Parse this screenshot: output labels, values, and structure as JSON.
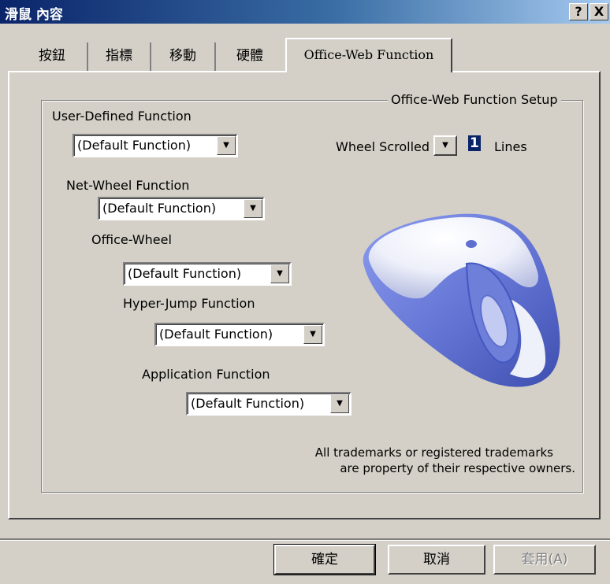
{
  "window": {
    "title": "滑鼠 內容",
    "help_label": "?",
    "close_label": "X"
  },
  "tabs": [
    {
      "label": "按鈕"
    },
    {
      "label": "指標"
    },
    {
      "label": "移動"
    },
    {
      "label": "硬體"
    },
    {
      "label": "Office-Web Function"
    }
  ],
  "group": {
    "title": "Office-Web Function Setup"
  },
  "fields": {
    "user_defined": {
      "label": "User-Defined Function",
      "value": "(Default Function)"
    },
    "net_wheel": {
      "label": "Net-Wheel Function",
      "value": "(Default Function)"
    },
    "office_wheel": {
      "label": "Office-Wheel",
      "value": "(Default Function)"
    },
    "hyper_jump": {
      "label": "Hyper-Jump Function",
      "value": "(Default Function)"
    },
    "application": {
      "label": "Application Function",
      "value": "(Default Function)"
    }
  },
  "wheel": {
    "label": "Wheel Scrolled",
    "value": "1",
    "unit": "Lines"
  },
  "trademark": {
    "line1": "All trademarks or registered trademarks",
    "line2": "are property of their respective owners."
  },
  "buttons": {
    "ok": "確定",
    "cancel": "取消",
    "apply": "套用(A)"
  },
  "icons": {
    "dropdown": "chevron-down-icon",
    "mouse": "mouse-illustration"
  },
  "colors": {
    "titlebar": "#0a246a",
    "face": "#d4d0c8",
    "mouse_accent": "#6d7fd9"
  }
}
